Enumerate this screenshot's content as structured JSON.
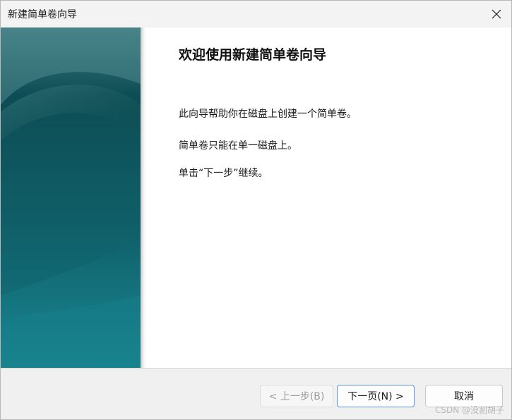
{
  "window": {
    "title": "新建简单卷向导"
  },
  "main": {
    "heading": "欢迎使用新建简单卷向导",
    "paragraphs": [
      "此向导帮助你在磁盘上创建一个简单卷。",
      "简单卷只能在单一磁盘上。",
      "单击“下一步”继续。"
    ]
  },
  "buttons": {
    "back": "< 上一步(B)",
    "next": "下一页(N) >",
    "cancel": "取消"
  },
  "watermark": "CSDN @没割胡子",
  "colors": {
    "banner_top": "#3f7b80",
    "banner_mid": "#12535c",
    "banner_bottom": "#137783",
    "primary_border": "#5b8fd6"
  },
  "icons": {
    "close": "close-icon"
  }
}
